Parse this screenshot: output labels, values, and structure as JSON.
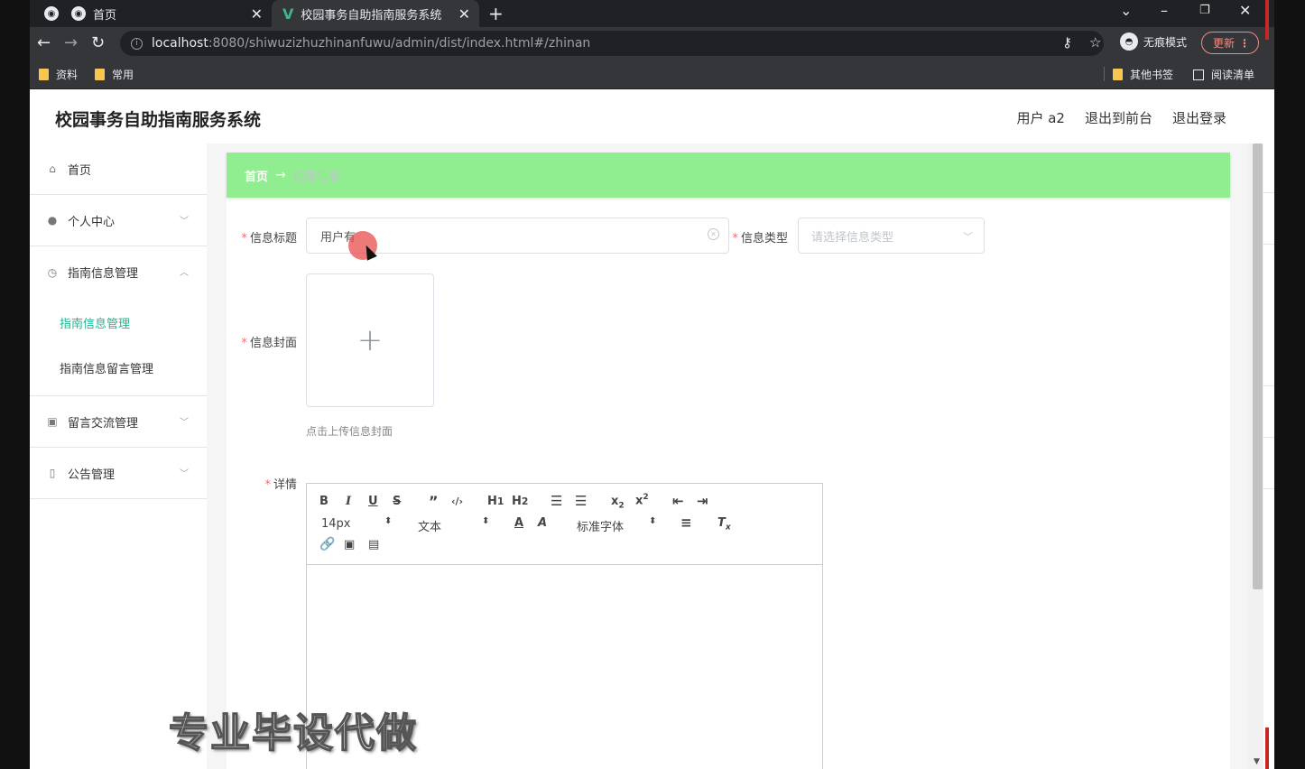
{
  "browser": {
    "tabs": [
      {
        "title": "首页"
      },
      {
        "title": "校园事务自助指南服务系统"
      }
    ],
    "url_host": "localhost",
    "url_path": ":8080/shiwuzizhuzhinanfuwu/admin/dist/index.html#/zhinan",
    "incognito_label": "无痕模式",
    "update_label": "更新",
    "bookmarks": [
      "资料",
      "常用"
    ],
    "other_bookmarks": "其他书签",
    "reading_list": "阅读清单"
  },
  "header": {
    "title": "校园事务自助指南服务系统",
    "user": "用户 a2",
    "to_front": "退出到前台",
    "logout": "退出登录"
  },
  "sidebar": {
    "home": "首页",
    "personal": "个人中心",
    "guide_mgmt": "指南信息管理",
    "guide_sub": "指南信息管理",
    "guide_comment_sub": "指南信息留言管理",
    "message_mgmt": "留言交流管理",
    "notice_mgmt": "公告管理"
  },
  "breadcrumb": {
    "home": "首页",
    "arrow": "→",
    "current": "指南信息"
  },
  "form": {
    "title_label": "信息标题",
    "title_value": "用户有",
    "type_label": "信息类型",
    "type_placeholder": "请选择信息类型",
    "cover_label": "信息封面",
    "cover_tip": "点击上传信息封面",
    "detail_label": "详情"
  },
  "editor": {
    "font_size": "14px",
    "text_style": "文本",
    "font_family": "标准字体"
  },
  "watermark": "专业毕设代做",
  "colors": {
    "breadcrumb_bg": "#90ee90",
    "active_menu": "#1fb58f",
    "required": "#f56c6c"
  }
}
